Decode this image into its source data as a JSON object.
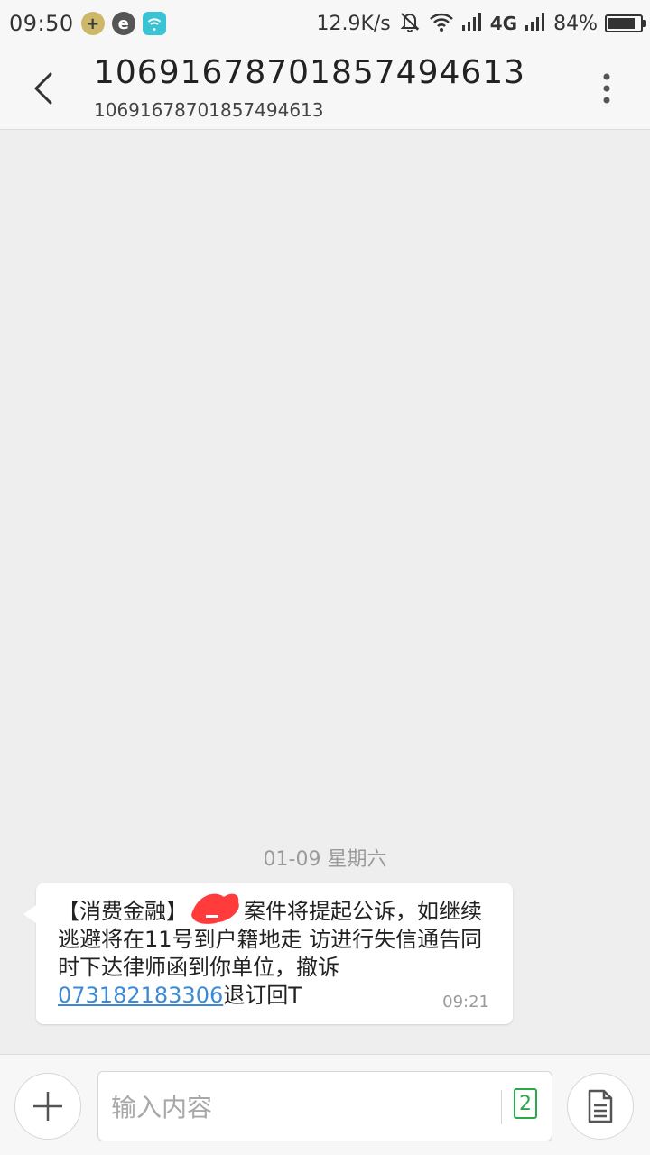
{
  "status_bar": {
    "time": "09:50",
    "net_speed": "12.9K/s",
    "network": "4G",
    "battery": "84%",
    "battery_level": 0.84
  },
  "header": {
    "title": "106916787018574946​13",
    "subtitle": "10691678701857494613"
  },
  "conversation": {
    "date_divider": "01-09  星期六",
    "message": {
      "text_prefix": "【消费金融】",
      "text_middle": "案件将提起公诉，如继续逃避将在11号到户籍地走 访进行失信通告同时下达律师函到你单位，撤诉",
      "phone": "073182183306",
      "text_suffix": "退订回T",
      "time": "09:21"
    }
  },
  "input_bar": {
    "placeholder": "输入内容",
    "sim_label": "2"
  },
  "colors": {
    "link": "#3a8ad8",
    "sim": "#2aa84a",
    "redaction": "#ff3b3b"
  }
}
